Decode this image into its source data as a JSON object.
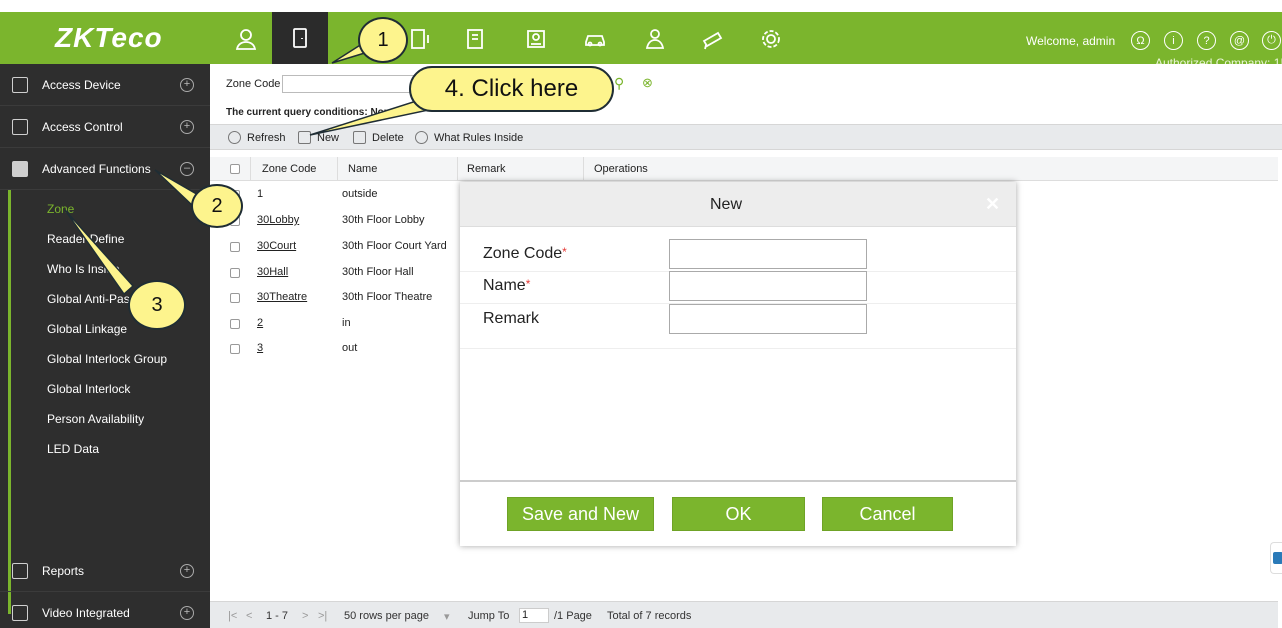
{
  "header": {
    "logo": "ZKTeco",
    "welcome": "Welcome, admin",
    "authorized": "Authorized Company: 1!",
    "nav_icons": [
      "person-icon",
      "door-icon",
      "elevator-icon",
      "building-icon",
      "visitor-icon",
      "parking-icon",
      "patrol-icon",
      "camera-icon",
      "settings-icon"
    ]
  },
  "sidebar": {
    "sections": [
      {
        "label": "Access Device"
      },
      {
        "label": "Access Control"
      },
      {
        "label": "Advanced Functions"
      },
      {
        "label": "Reports"
      },
      {
        "label": "Video Integrated"
      }
    ],
    "submenu": [
      {
        "label": "Zone"
      },
      {
        "label": "Reader Define"
      },
      {
        "label": "Who Is Inside"
      },
      {
        "label": "Global Anti-Passback"
      },
      {
        "label": "Global Linkage"
      },
      {
        "label": "Global Interlock Group"
      },
      {
        "label": "Global Interlock"
      },
      {
        "label": "Person Availability"
      },
      {
        "label": "LED Data"
      }
    ]
  },
  "query": {
    "zone_code_label": "Zone Code",
    "condition": "The current query conditions: None"
  },
  "toolbar": {
    "refresh": "Refresh",
    "new": "New",
    "delete": "Delete",
    "rules": "What Rules Inside"
  },
  "table": {
    "columns": [
      "Zone Code",
      "Name",
      "Remark",
      "Operations"
    ],
    "rows": [
      {
        "code": "1",
        "name": "outside"
      },
      {
        "code": "30Lobby",
        "name": "30th Floor Lobby"
      },
      {
        "code": "30Court",
        "name": "30th Floor Court Yard"
      },
      {
        "code": "30Hall",
        "name": "30th Floor Hall"
      },
      {
        "code": "30Theatre",
        "name": "30th Floor Theatre"
      },
      {
        "code": "2",
        "name": "in"
      },
      {
        "code": "3",
        "name": "out"
      }
    ]
  },
  "pager": {
    "range": "1 - 7",
    "per_page": "50 rows per page",
    "jump_label": "Jump To",
    "jump_value": "1",
    "page_total": "/1 Page",
    "records": "Total of 7 records"
  },
  "dialog": {
    "title": "New",
    "fields": [
      {
        "label": "Zone Code",
        "required": "*"
      },
      {
        "label": "Name",
        "required": "*"
      },
      {
        "label": "Remark",
        "required": ""
      }
    ],
    "buttons": {
      "save_new": "Save and New",
      "ok": "OK",
      "cancel": "Cancel"
    }
  },
  "annotations": {
    "c1": "1",
    "c2": "2",
    "c3": "3",
    "c4": "4. Click here"
  },
  "colors": {
    "brand_green": "#7bb52d",
    "sidebar_dark": "#2e2e2e",
    "callout_yellow": "#fdf48d"
  }
}
